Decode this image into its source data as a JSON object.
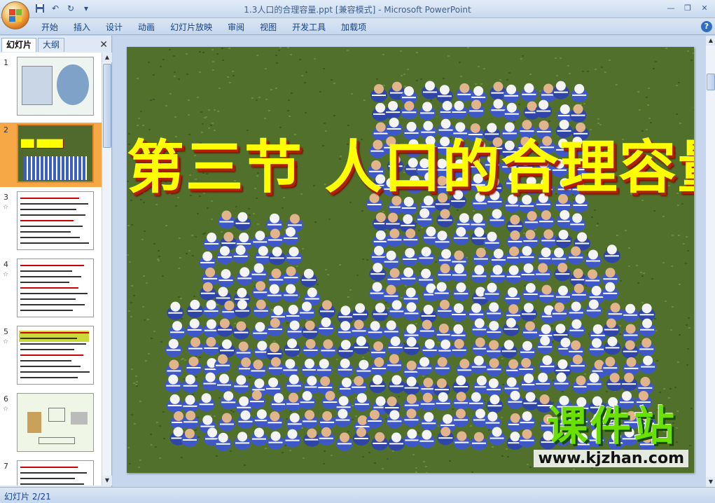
{
  "window": {
    "title": "1.3人口的合理容量.ppt [兼容模式] - Microsoft PowerPoint"
  },
  "quick_access": [
    "save-icon",
    "undo-icon",
    "redo-icon",
    "customize-icon"
  ],
  "ribbon": {
    "tabs": [
      "开始",
      "插入",
      "设计",
      "动画",
      "幻灯片放映",
      "审阅",
      "视图",
      "开发工具",
      "加载项"
    ]
  },
  "left_pane": {
    "tabs": [
      "幻灯片",
      "大纲"
    ],
    "close_symbol": "✕",
    "anim_mark": "☆",
    "slides": [
      {
        "num": "1",
        "animated": false
      },
      {
        "num": "2",
        "animated": false,
        "selected": true
      },
      {
        "num": "3",
        "animated": true
      },
      {
        "num": "4",
        "animated": true
      },
      {
        "num": "5",
        "animated": true
      },
      {
        "num": "6",
        "animated": true
      },
      {
        "num": "7",
        "animated": false
      }
    ]
  },
  "slide": {
    "title": "第三节  人口的合理容量",
    "watermark_cn": "课件站",
    "watermark_url": "www.kjzhan.com"
  },
  "status": {
    "slide_indicator": "幻灯片 2/21"
  },
  "colors": {
    "title_yellow": "#ffff00",
    "grass": "#4f6a2c",
    "selected_thumb": "#f7a846"
  }
}
